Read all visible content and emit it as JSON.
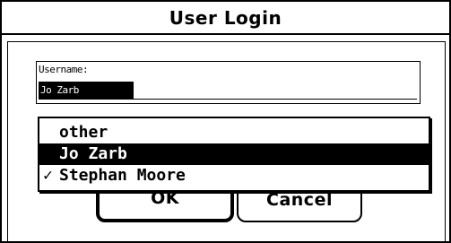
{
  "dialog": {
    "title": "User Login"
  },
  "username": {
    "label": "Username:",
    "value": "Jo Zarb"
  },
  "menu": {
    "items": [
      {
        "label": "other",
        "checked": false,
        "highlighted": false
      },
      {
        "label": "Jo Zarb",
        "checked": false,
        "highlighted": true
      },
      {
        "label": "Stephan Moore",
        "checked": true,
        "highlighted": false
      }
    ],
    "check_glyph": "✓"
  },
  "buttons": {
    "ok_label": "OK",
    "cancel_label": "Cancel"
  }
}
